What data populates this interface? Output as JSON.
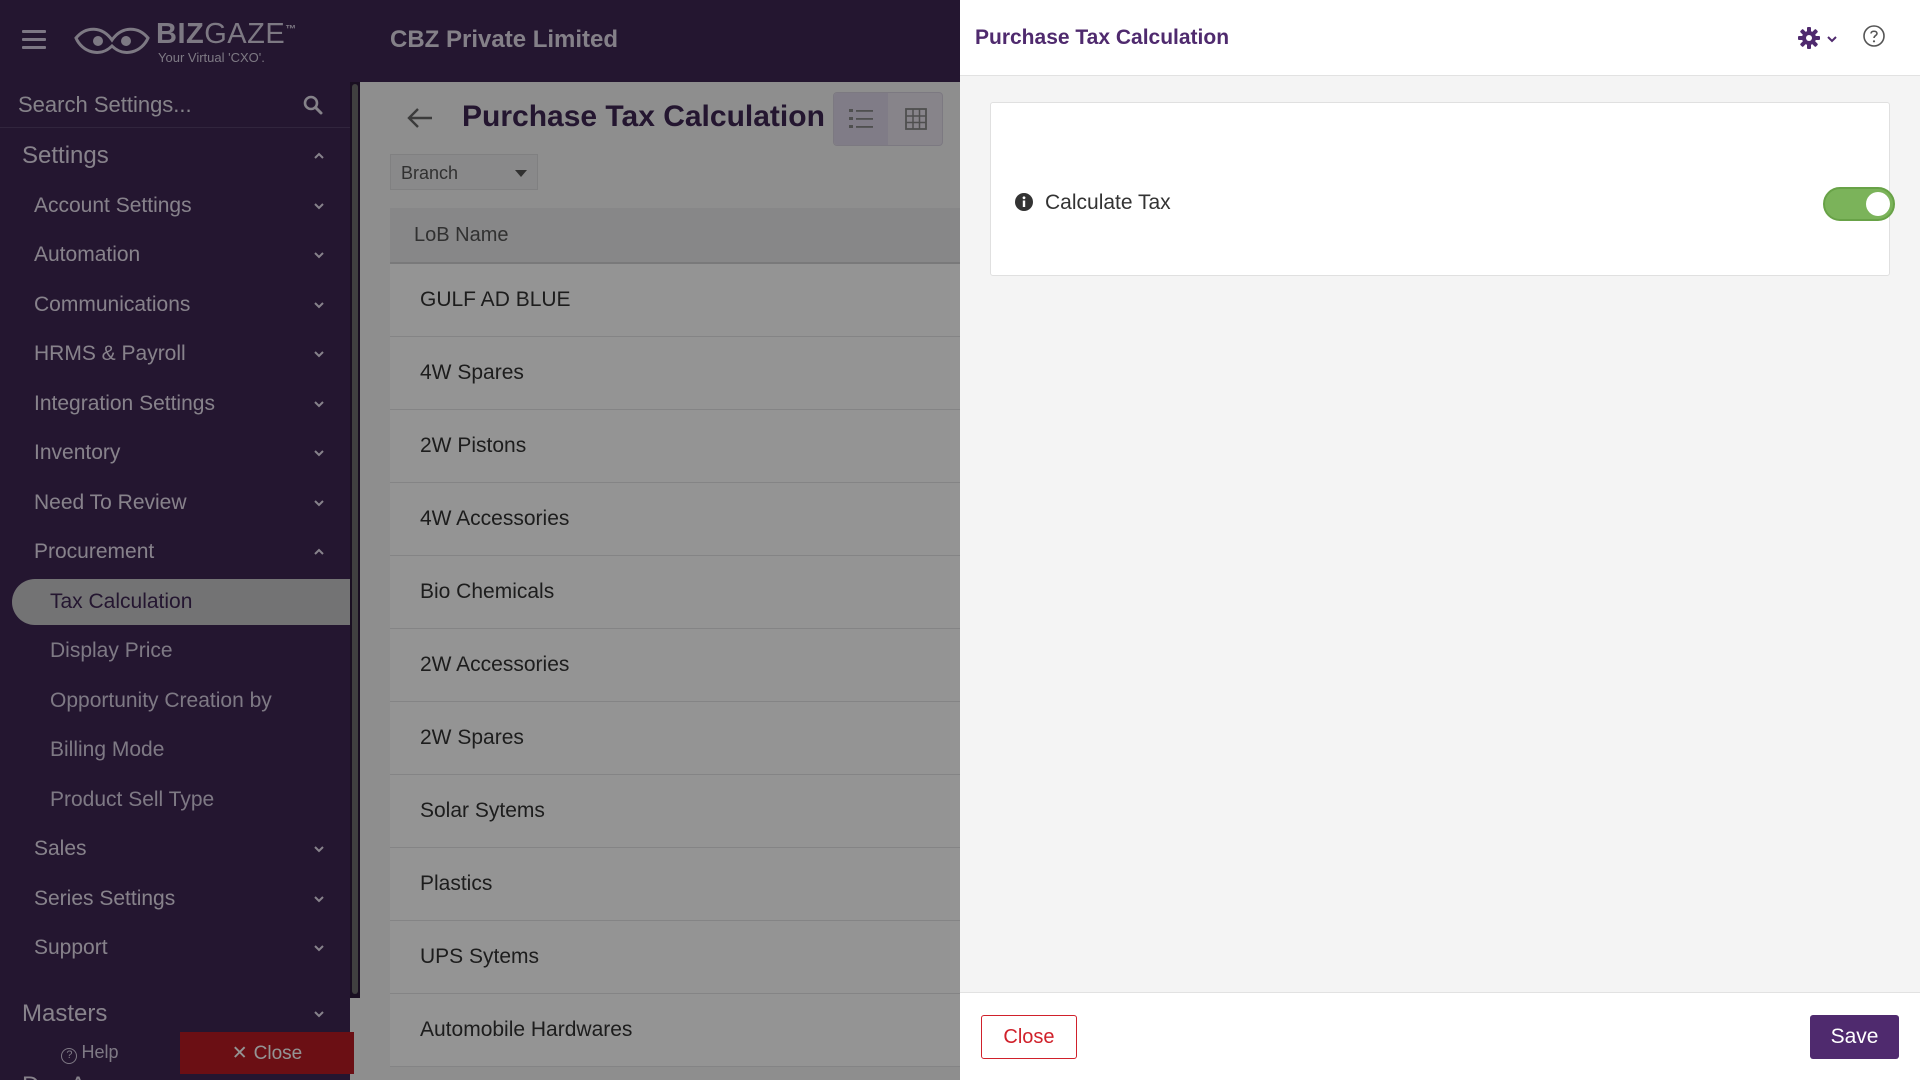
{
  "colors": {
    "brand": "#3f2654",
    "panel_title": "#4f2a6e",
    "toggle_on": "#7bb35a",
    "danger": "#d0212b",
    "save": "#4f2a6e"
  },
  "header": {
    "logo_primary": "BIZ",
    "logo_secondary": "GAZE",
    "logo_tm": "™",
    "logo_tagline": "Your Virtual 'CXO'.",
    "company": "CBZ Private Limited",
    "menu_icon": "hamburger-icon"
  },
  "sidebar": {
    "search_placeholder": "Search Settings...",
    "search_icon": "search-icon",
    "settings_label": "Settings",
    "groups": [
      {
        "label": "Account Settings",
        "expanded": false
      },
      {
        "label": "Automation",
        "expanded": false
      },
      {
        "label": "Communications",
        "expanded": false
      },
      {
        "label": "HRMS & Payroll",
        "expanded": false
      },
      {
        "label": "Integration Settings",
        "expanded": false
      },
      {
        "label": "Inventory",
        "expanded": false
      },
      {
        "label": "Need To Review",
        "expanded": false
      },
      {
        "label": "Procurement",
        "expanded": true
      },
      {
        "label": "Sales",
        "expanded": false
      },
      {
        "label": "Series Settings",
        "expanded": false
      },
      {
        "label": "Support",
        "expanded": false
      }
    ],
    "procurement_items": [
      {
        "label": "Tax Calculation",
        "active": true
      },
      {
        "label": "Display Price",
        "active": false
      },
      {
        "label": "Opportunity Creation by",
        "active": false
      },
      {
        "label": "Billing Mode",
        "active": false
      },
      {
        "label": "Product Sell Type",
        "active": false
      }
    ],
    "masters_label": "Masters",
    "devapps_label": "Dev Apps",
    "help_label": "Help",
    "close_label": "Close"
  },
  "main": {
    "title": "Purchase Tax Calculation",
    "branch_select": "Branch",
    "column_header": "LoB Name",
    "rows": [
      "GULF AD BLUE",
      "4W Spares",
      "2W Pistons",
      "4W Accessories",
      "Bio Chemicals",
      "2W Accessories",
      "2W Spares",
      "Solar Sytems",
      "Plastics",
      "UPS Sytems",
      "Automobile Hardwares"
    ]
  },
  "panel": {
    "title": "Purchase Tax Calculation",
    "field_label": "Calculate Tax",
    "field_value_on": true,
    "close_label": "Close",
    "save_label": "Save"
  }
}
